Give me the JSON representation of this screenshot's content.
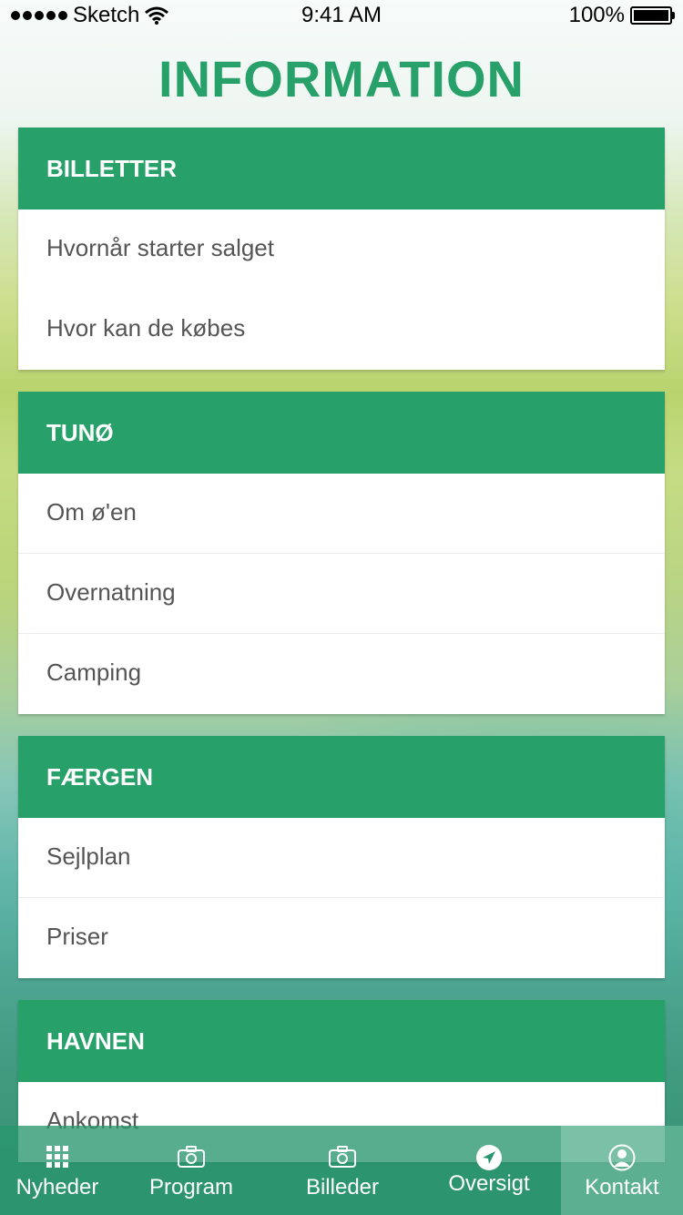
{
  "status_bar": {
    "carrier": "Sketch",
    "time": "9:41 AM",
    "battery": "100%"
  },
  "title": "INFORMATION",
  "sections": [
    {
      "header": "BILLETTER",
      "items": [
        "Hvornår starter salget",
        "Hvor kan de købes"
      ]
    },
    {
      "header": "TUNØ",
      "items": [
        "Om ø'en",
        "Overnatning",
        "Camping"
      ]
    },
    {
      "header": "FÆRGEN",
      "items": [
        "Sejlplan",
        "Priser"
      ]
    },
    {
      "header": "HAVNEN",
      "items": [
        "Ankomst"
      ]
    }
  ],
  "tabs": [
    {
      "label": "Nyheder",
      "icon": "grid-icon"
    },
    {
      "label": "Program",
      "icon": "camera-icon"
    },
    {
      "label": "Billeder",
      "icon": "camera-icon"
    },
    {
      "label": "Oversigt",
      "icon": "location-arrow-icon"
    },
    {
      "label": "Kontakt",
      "icon": "user-circle-icon",
      "active": true
    }
  ],
  "colors": {
    "accent": "#27a06a",
    "tabbar": "#2a9670"
  }
}
